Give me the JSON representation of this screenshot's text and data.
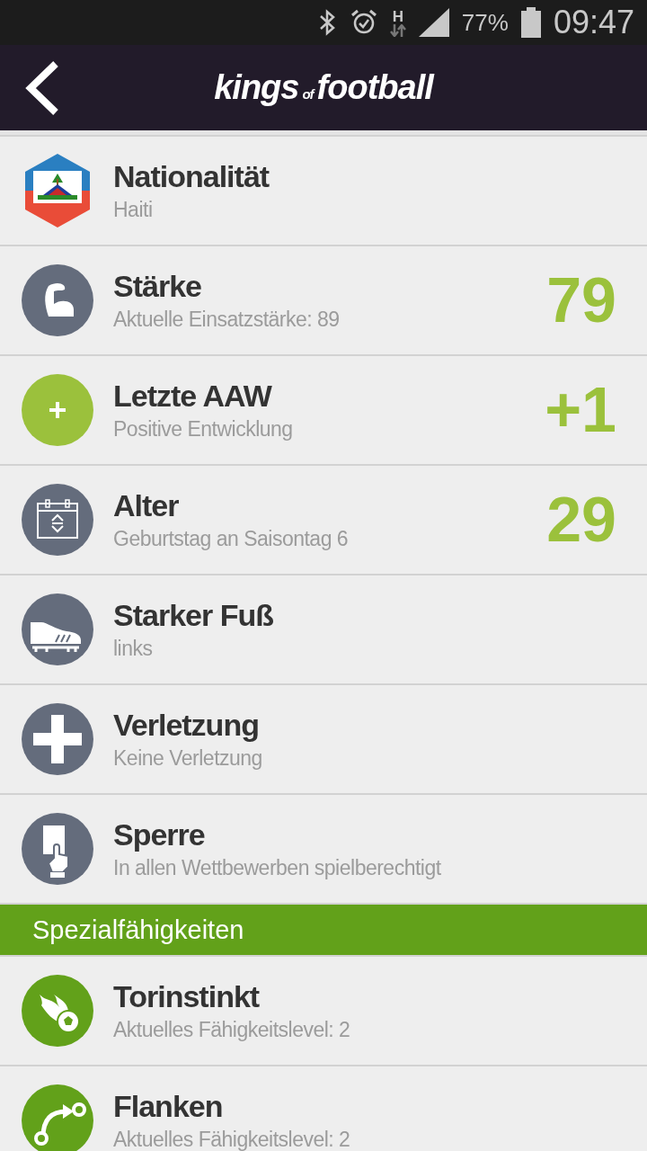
{
  "status_bar": {
    "battery": "77%",
    "time": "09:47",
    "network": "H"
  },
  "header": {
    "logo": [
      "kings",
      "of",
      "football"
    ]
  },
  "rows": [
    {
      "title": "Nationalität",
      "subtitle": "Haiti"
    },
    {
      "title": "Stärke",
      "subtitle": "Aktuelle Einsatzstärke: 89",
      "value": "79"
    },
    {
      "title": "Letzte AAW",
      "subtitle": "Positive Entwicklung",
      "value": "+1"
    },
    {
      "title": "Alter",
      "subtitle": "Geburtstag an Saisontag 6",
      "value": "29"
    },
    {
      "title": "Starker Fuß",
      "subtitle": "links"
    },
    {
      "title": "Verletzung",
      "subtitle": "Keine Verletzung"
    },
    {
      "title": "Sperre",
      "subtitle": "In allen Wettbewerben spielberechtigt"
    }
  ],
  "section": {
    "title": "Spezialfähigkeiten",
    "rows": [
      {
        "title": "Torinstinkt",
        "subtitle": "Aktuelles Fähigkeitslevel: 2"
      },
      {
        "title": "Flanken",
        "subtitle": "Aktuelles Fähigkeitslevel: 2"
      }
    ]
  }
}
